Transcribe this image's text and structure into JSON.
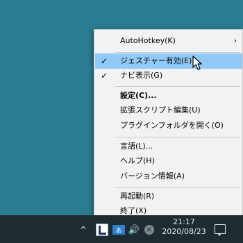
{
  "menu": {
    "items": [
      {
        "label": "AutoHotkey(K)",
        "checked": false,
        "submenu": true
      },
      {
        "label": "ジェスチャー有効(E)",
        "checked": true,
        "highlighted": true
      },
      {
        "label": "ナビ表示(G)",
        "checked": true
      },
      {
        "label": "設定(C)...",
        "bold": true
      },
      {
        "label": "拡張スクリプト編集(U)"
      },
      {
        "label": "プラグインフォルダを開く(O)"
      },
      {
        "label": "言語(L)..."
      },
      {
        "label": "ヘルプ(H)"
      },
      {
        "label": "バージョン情報(A)"
      },
      {
        "label": "再起動(R)"
      },
      {
        "label": "終了(X)"
      }
    ],
    "check_glyph": "✓",
    "submenu_glyph": "›",
    "highlight_color": "#91c9f7"
  },
  "taskbar": {
    "chevron_glyph": "^",
    "ime_label": "あ",
    "volume_glyph": "🔊",
    "close_glyph": "×",
    "clock_time": "21:17",
    "clock_date": "2020/08/23"
  },
  "desktop": {
    "background": "#2b7c93"
  }
}
